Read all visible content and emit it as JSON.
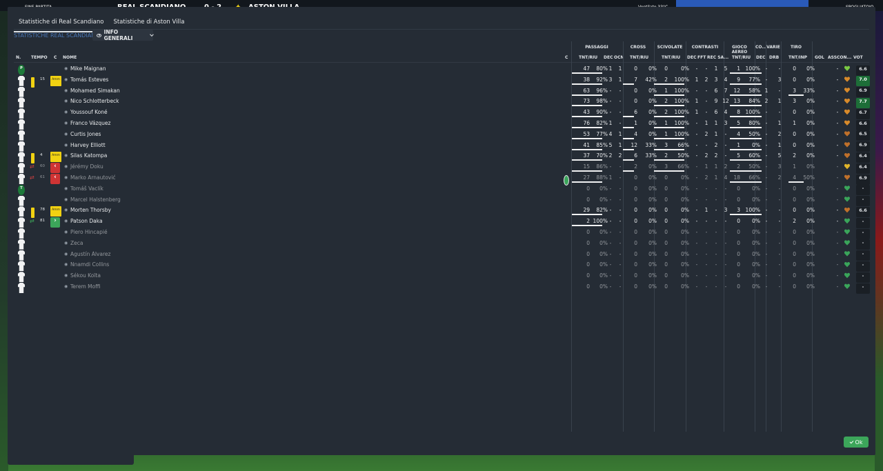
{
  "topbar": {
    "label": "FINE PARTITA",
    "home_team": "REAL SCANDIANO",
    "score": "0 - 2",
    "away_team": "ASTON VILLA",
    "weather": "Ventilato 33°C",
    "right_label": "SPOGLIATOIO",
    "colors": {
      "away_crest": "#f1d212",
      "accent": "#2a5ab8"
    }
  },
  "tabs": [
    "Statistiche di Real Scandiano",
    "Statistiche di Aston Villa"
  ],
  "subtitle": "STATISTICHE REAL SCANDIANO",
  "view_dropdown": "INFO GENERALI",
  "groups": {
    "passaggi": "PASSAGGI",
    "cross": "CROSS",
    "scivolate": "SCIVOLATE",
    "contrasti": "CONTRASTI",
    "gioco_aereo": "GIOCO AEREO",
    "co": "CO...",
    "varie": "VARIE",
    "tiro": "TIRO"
  },
  "headers": {
    "n": "N.",
    "tempo": "TEMPO",
    "c": "C",
    "nome": "NOME",
    "c2": "C",
    "pass_tnt": "TNT/RIU",
    "pass_dec": "DEC",
    "pass_ocn": "OCN",
    "cross_tnt": "TNT/RIU",
    "sciv_tnt": "TNT/RIU",
    "con_dec": "DEC",
    "con_fft": "FFT",
    "con_rec": "REC SA...",
    "aer_tnt": "TNT/RIU",
    "co_dec": "DEC",
    "drb": "DRB",
    "tiro": "TNT/INP",
    "gol": "GOL",
    "ass": "ASS",
    "con": "CON...",
    "vot": "VOT"
  },
  "players": [
    {
      "pos": "P",
      "card": "",
      "time": "",
      "badge": "",
      "name": "Mike Maignan",
      "sub": false,
      "c": "",
      "p_t": "47",
      "p_p": "80%",
      "p_d": "1",
      "p_o": "1",
      "cr_t": "0",
      "cr_p": "0%",
      "sv_t": "0",
      "sv_p": "0%",
      "k_d": "-",
      "k_f": "-",
      "k_r": "1",
      "k_s": "5",
      "a_t": "1",
      "a_p": "100%",
      "co": "-",
      "drb": "-",
      "t_t": "0",
      "t_p": "0%",
      "gol": "",
      "ass": "-",
      "heart": "#7ac943",
      "vot": "6.6",
      "good": false
    },
    {
      "pos": "",
      "card": "y",
      "time": "15",
      "badge": "amm",
      "name": "Tomás Esteves",
      "sub": false,
      "c": "",
      "p_t": "38",
      "p_p": "92%",
      "p_d": "3",
      "p_o": "1",
      "cr_t": "7",
      "cr_p": "42%",
      "sv_t": "2",
      "sv_p": "100%",
      "k_d": "1",
      "k_f": "2",
      "k_r": "3",
      "k_s": "4",
      "a_t": "9",
      "a_p": "77%",
      "co": "-",
      "drb": "3",
      "t_t": "0",
      "t_p": "0%",
      "gol": "",
      "ass": "-",
      "heart": "#d88a2a",
      "vot": "7.0",
      "good": true
    },
    {
      "pos": "",
      "card": "",
      "time": "",
      "badge": "",
      "name": "Mohamed Simakan",
      "sub": false,
      "c": "",
      "p_t": "63",
      "p_p": "96%",
      "p_d": "-",
      "p_o": "-",
      "cr_t": "0",
      "cr_p": "0%",
      "sv_t": "1",
      "sv_p": "100%",
      "k_d": "-",
      "k_f": "-",
      "k_r": "6",
      "k_s": "7",
      "a_t": "12",
      "a_p": "58%",
      "co": "1",
      "drb": "-",
      "t_t": "3",
      "t_p": "33%",
      "gol": "",
      "ass": "-",
      "heart": "#d88a2a",
      "vot": "6.9",
      "good": false
    },
    {
      "pos": "",
      "card": "",
      "time": "",
      "badge": "",
      "name": "Nico Schlotterbeck",
      "sub": false,
      "c": "",
      "p_t": "73",
      "p_p": "98%",
      "p_d": "-",
      "p_o": "-",
      "cr_t": "0",
      "cr_p": "0%",
      "sv_t": "2",
      "sv_p": "100%",
      "k_d": "1",
      "k_f": "-",
      "k_r": "9",
      "k_s": "12",
      "a_t": "13",
      "a_p": "84%",
      "co": "2",
      "drb": "1",
      "t_t": "3",
      "t_p": "0%",
      "gol": "",
      "ass": "-",
      "heart": "#d88a2a",
      "vot": "7.7",
      "good": true
    },
    {
      "pos": "",
      "card": "",
      "time": "",
      "badge": "",
      "name": "Youssouf Koné",
      "sub": false,
      "c": "",
      "p_t": "43",
      "p_p": "90%",
      "p_d": "-",
      "p_o": "-",
      "cr_t": "6",
      "cr_p": "0%",
      "sv_t": "2",
      "sv_p": "100%",
      "k_d": "1",
      "k_f": "-",
      "k_r": "6",
      "k_s": "4",
      "a_t": "8",
      "a_p": "100%",
      "co": "-",
      "drb": "-",
      "t_t": "0",
      "t_p": "0%",
      "gol": "",
      "ass": "-",
      "heart": "#d88a2a",
      "vot": "6.7",
      "good": false
    },
    {
      "pos": "",
      "card": "",
      "time": "",
      "badge": "",
      "name": "Franco Vázquez",
      "sub": false,
      "c": "",
      "p_t": "76",
      "p_p": "82%",
      "p_d": "1",
      "p_o": "-",
      "cr_t": "1",
      "cr_p": "0%",
      "sv_t": "1",
      "sv_p": "100%",
      "k_d": "-",
      "k_f": "1",
      "k_r": "1",
      "k_s": "3",
      "a_t": "5",
      "a_p": "80%",
      "co": "-",
      "drb": "1",
      "t_t": "1",
      "t_p": "0%",
      "gol": "",
      "ass": "-",
      "heart": "#d88a2a",
      "vot": "6.6",
      "good": false
    },
    {
      "pos": "",
      "card": "",
      "time": "",
      "badge": "",
      "name": "Curtis Jones",
      "sub": false,
      "c": "",
      "p_t": "53",
      "p_p": "77%",
      "p_d": "4",
      "p_o": "1",
      "cr_t": "4",
      "cr_p": "0%",
      "sv_t": "1",
      "sv_p": "100%",
      "k_d": "-",
      "k_f": "2",
      "k_r": "1",
      "k_s": "-",
      "a_t": "4",
      "a_p": "50%",
      "co": "-",
      "drb": "2",
      "t_t": "0",
      "t_p": "0%",
      "gol": "",
      "ass": "-",
      "heart": "#c0702a",
      "vot": "6.5",
      "good": false
    },
    {
      "pos": "",
      "card": "",
      "time": "",
      "badge": "",
      "name": "Harvey Elliott",
      "sub": false,
      "c": "",
      "p_t": "41",
      "p_p": "85%",
      "p_d": "5",
      "p_o": "1",
      "cr_t": "12",
      "cr_p": "33%",
      "sv_t": "3",
      "sv_p": "66%",
      "k_d": "-",
      "k_f": "-",
      "k_r": "2",
      "k_s": "-",
      "a_t": "1",
      "a_p": "0%",
      "co": "-",
      "drb": "1",
      "t_t": "0",
      "t_p": "0%",
      "gol": "",
      "ass": "-",
      "heart": "#c0702a",
      "vot": "6.9",
      "good": false
    },
    {
      "pos": "",
      "card": "y",
      "time": "4",
      "badge": "amm",
      "name": "Silas Katompa",
      "sub": false,
      "c": "",
      "p_t": "37",
      "p_p": "70%",
      "p_d": "2",
      "p_o": "2",
      "cr_t": "6",
      "cr_p": "33%",
      "sv_t": "2",
      "sv_p": "50%",
      "k_d": "-",
      "k_f": "2",
      "k_r": "2",
      "k_s": "-",
      "a_t": "5",
      "a_p": "60%",
      "co": "-",
      "drb": "5",
      "t_t": "2",
      "t_p": "0%",
      "gol": "",
      "ass": "-",
      "heart": "#c0702a",
      "vot": "6.4",
      "good": false
    },
    {
      "pos": "",
      "card": "out",
      "time": "60",
      "badge": "out",
      "name": "Jérémy Doku",
      "sub": true,
      "c": "",
      "p_t": "15",
      "p_p": "86%",
      "p_d": "-",
      "p_o": "-",
      "cr_t": "2",
      "cr_p": "0%",
      "sv_t": "3",
      "sv_p": "66%",
      "k_d": "-",
      "k_f": "1",
      "k_r": "1",
      "k_s": "2",
      "a_t": "2",
      "a_p": "50%",
      "co": "-",
      "drb": "3",
      "t_t": "1",
      "t_p": "0%",
      "gol": "",
      "ass": "-",
      "heart": "#e0b42a",
      "vot": "6.4",
      "good": false
    },
    {
      "pos": "",
      "card": "out",
      "time": "61",
      "badge": "out",
      "name": "Marko Arnautović",
      "sub": true,
      "c": "ball",
      "p_t": "27",
      "p_p": "88%",
      "p_d": "1",
      "p_o": "-",
      "cr_t": "0",
      "cr_p": "0%",
      "sv_t": "0",
      "sv_p": "0%",
      "k_d": "-",
      "k_f": "2",
      "k_r": "1",
      "k_s": "4",
      "a_t": "18",
      "a_p": "66%",
      "co": "-",
      "drb": "2",
      "t_t": "4",
      "t_p": "50%",
      "gol": "",
      "ass": "-",
      "heart": "#c0702a",
      "vot": "6.9",
      "good": false
    },
    {
      "pos": "T",
      "card": "",
      "time": "",
      "badge": "",
      "name": "Tomáš Vaclík",
      "sub": true,
      "c": "",
      "p_t": "0",
      "p_p": "0%",
      "p_d": "-",
      "p_o": "-",
      "cr_t": "0",
      "cr_p": "0%",
      "sv_t": "0",
      "sv_p": "0%",
      "k_d": "-",
      "k_f": "-",
      "k_r": "-",
      "k_s": "-",
      "a_t": "0",
      "a_p": "0%",
      "co": "-",
      "drb": "-",
      "t_t": "0",
      "t_p": "0%",
      "gol": "",
      "ass": "-",
      "heart": "#3aa55a",
      "vot": "-",
      "good": false
    },
    {
      "pos": "",
      "card": "",
      "time": "",
      "badge": "",
      "name": "Marcel Halstenberg",
      "sub": true,
      "c": "",
      "p_t": "0",
      "p_p": "0%",
      "p_d": "-",
      "p_o": "-",
      "cr_t": "0",
      "cr_p": "0%",
      "sv_t": "0",
      "sv_p": "0%",
      "k_d": "-",
      "k_f": "-",
      "k_r": "-",
      "k_s": "-",
      "a_t": "0",
      "a_p": "0%",
      "co": "-",
      "drb": "-",
      "t_t": "0",
      "t_p": "0%",
      "gol": "",
      "ass": "-",
      "heart": "#3aa55a",
      "vot": "-",
      "good": false
    },
    {
      "pos": "",
      "card": "y",
      "time": "78",
      "badge": "amm",
      "name": "Morten Thorsby",
      "sub": false,
      "c": "",
      "p_t": "29",
      "p_p": "82%",
      "p_d": "-",
      "p_o": "-",
      "cr_t": "0",
      "cr_p": "0%",
      "sv_t": "0",
      "sv_p": "0%",
      "k_d": "-",
      "k_f": "1",
      "k_r": "-",
      "k_s": "3",
      "a_t": "3",
      "a_p": "100%",
      "co": "-",
      "drb": "-",
      "t_t": "0",
      "t_p": "0%",
      "gol": "",
      "ass": "-",
      "heart": "#c0702a",
      "vot": "6.6",
      "good": false
    },
    {
      "pos": "",
      "card": "in",
      "time": "81",
      "badge": "in",
      "name": "Patson Daka",
      "sub": false,
      "c": "",
      "p_t": "2",
      "p_p": "100%",
      "p_d": "-",
      "p_o": "-",
      "cr_t": "0",
      "cr_p": "0%",
      "sv_t": "0",
      "sv_p": "0%",
      "k_d": "-",
      "k_f": "-",
      "k_r": "-",
      "k_s": "-",
      "a_t": "0",
      "a_p": "0%",
      "co": "-",
      "drb": "-",
      "t_t": "2",
      "t_p": "0%",
      "gol": "",
      "ass": "-",
      "heart": "#3aa55a",
      "vot": "-",
      "good": false
    },
    {
      "pos": "",
      "card": "",
      "time": "",
      "badge": "",
      "name": "Piero Hincapié",
      "sub": true,
      "c": "",
      "p_t": "0",
      "p_p": "0%",
      "p_d": "-",
      "p_o": "-",
      "cr_t": "0",
      "cr_p": "0%",
      "sv_t": "0",
      "sv_p": "0%",
      "k_d": "-",
      "k_f": "-",
      "k_r": "-",
      "k_s": "-",
      "a_t": "0",
      "a_p": "0%",
      "co": "-",
      "drb": "-",
      "t_t": "0",
      "t_p": "0%",
      "gol": "",
      "ass": "-",
      "heart": "#3aa55a",
      "vot": "-",
      "good": false
    },
    {
      "pos": "",
      "card": "",
      "time": "",
      "badge": "",
      "name": "Zeca",
      "sub": true,
      "c": "",
      "p_t": "0",
      "p_p": "0%",
      "p_d": "-",
      "p_o": "-",
      "cr_t": "0",
      "cr_p": "0%",
      "sv_t": "0",
      "sv_p": "0%",
      "k_d": "-",
      "k_f": "-",
      "k_r": "-",
      "k_s": "-",
      "a_t": "0",
      "a_p": "0%",
      "co": "-",
      "drb": "-",
      "t_t": "0",
      "t_p": "0%",
      "gol": "",
      "ass": "-",
      "heart": "#3aa55a",
      "vot": "-",
      "good": false
    },
    {
      "pos": "",
      "card": "",
      "time": "",
      "badge": "",
      "name": "Agustín Álvarez",
      "sub": true,
      "c": "",
      "p_t": "0",
      "p_p": "0%",
      "p_d": "-",
      "p_o": "-",
      "cr_t": "0",
      "cr_p": "0%",
      "sv_t": "0",
      "sv_p": "0%",
      "k_d": "-",
      "k_f": "-",
      "k_r": "-",
      "k_s": "-",
      "a_t": "0",
      "a_p": "0%",
      "co": "-",
      "drb": "-",
      "t_t": "0",
      "t_p": "0%",
      "gol": "",
      "ass": "-",
      "heart": "#3aa55a",
      "vot": "-",
      "good": false
    },
    {
      "pos": "",
      "card": "",
      "time": "",
      "badge": "",
      "name": "Nnamdi Collins",
      "sub": true,
      "c": "",
      "p_t": "0",
      "p_p": "0%",
      "p_d": "-",
      "p_o": "-",
      "cr_t": "0",
      "cr_p": "0%",
      "sv_t": "0",
      "sv_p": "0%",
      "k_d": "-",
      "k_f": "-",
      "k_r": "-",
      "k_s": "-",
      "a_t": "0",
      "a_p": "0%",
      "co": "-",
      "drb": "-",
      "t_t": "0",
      "t_p": "0%",
      "gol": "",
      "ass": "-",
      "heart": "#3aa55a",
      "vot": "-",
      "good": false
    },
    {
      "pos": "",
      "card": "",
      "time": "",
      "badge": "",
      "name": "Sékou Koïta",
      "sub": true,
      "c": "",
      "p_t": "0",
      "p_p": "0%",
      "p_d": "-",
      "p_o": "-",
      "cr_t": "0",
      "cr_p": "0%",
      "sv_t": "0",
      "sv_p": "0%",
      "k_d": "-",
      "k_f": "-",
      "k_r": "-",
      "k_s": "-",
      "a_t": "0",
      "a_p": "0%",
      "co": "-",
      "drb": "-",
      "t_t": "0",
      "t_p": "0%",
      "gol": "",
      "ass": "-",
      "heart": "#3aa55a",
      "vot": "-",
      "good": false
    },
    {
      "pos": "",
      "card": "",
      "time": "",
      "badge": "",
      "name": "Terem Moffi",
      "sub": true,
      "c": "",
      "p_t": "0",
      "p_p": "0%",
      "p_d": "-",
      "p_o": "-",
      "cr_t": "0",
      "cr_p": "0%",
      "sv_t": "0",
      "sv_p": "0%",
      "k_d": "-",
      "k_f": "-",
      "k_r": "-",
      "k_s": "-",
      "a_t": "0",
      "a_p": "0%",
      "co": "-",
      "drb": "-",
      "t_t": "0",
      "t_p": "0%",
      "gol": "",
      "ass": "-",
      "heart": "#3aa55a",
      "vot": "-",
      "good": false
    }
  ],
  "ok_label": "Ok"
}
